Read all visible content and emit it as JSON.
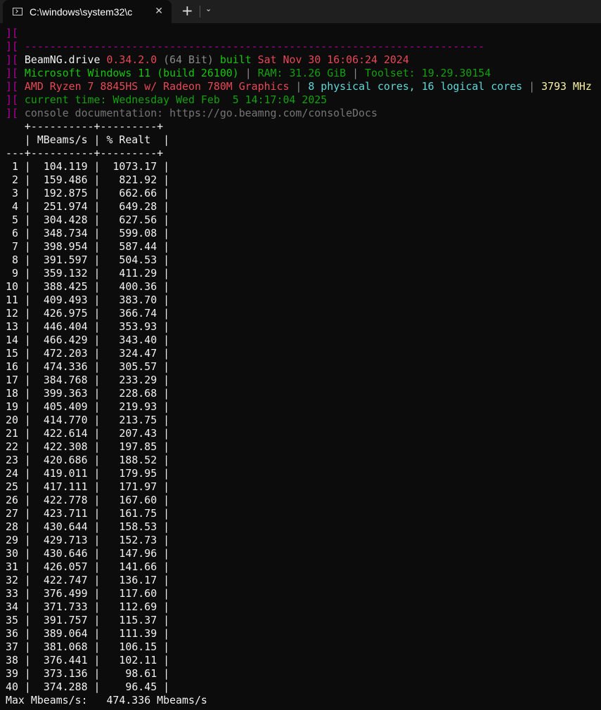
{
  "window": {
    "tab_title": "C:\\windows\\system32\\c",
    "tab_icon": "console-icon",
    "close_glyph": "✕",
    "new_tab_glyph": "+",
    "dropdown_glyph": "⌄"
  },
  "header": {
    "prefix": "][",
    "dashes": "-------------------------------------------------------------------------",
    "line1": {
      "app": "BeamNG.drive",
      "version": "0.34.2.0",
      "arch": "(64 Bit)",
      "built_label": "built",
      "build_date": "Sat Nov 30 16:06:24 2024"
    },
    "line2": {
      "os": "Microsoft Windows 11 (build 26100)",
      "ram": "RAM: 31.26 GiB",
      "toolset": "Toolset: 19.29.30154"
    },
    "line3": {
      "cpu": "AMD Ryzen 7 8845HS w/ Radeon 780M Graphics",
      "cores": "8 physical cores, 16 logical cores",
      "mhz": "3793 MHz"
    },
    "line4": "current time: Wednesday Wed Feb  5 14:17:04 2025",
    "line5": "console documentation: https://go.beamng.com/consoleDocs"
  },
  "table": {
    "border_top": "   +----------+---------+",
    "header_row": "   | MBeams/s | % Realt  |",
    "header_sep": "---+----------+---------+",
    "rows": [
      [
        " 1",
        "104.119",
        "1073.17"
      ],
      [
        " 2",
        "159.486",
        "821.92"
      ],
      [
        " 3",
        "192.875",
        "662.66"
      ],
      [
        " 4",
        "251.974",
        "649.28"
      ],
      [
        " 5",
        "304.428",
        "627.56"
      ],
      [
        " 6",
        "348.734",
        "599.08"
      ],
      [
        " 7",
        "398.954",
        "587.44"
      ],
      [
        " 8",
        "391.597",
        "504.53"
      ],
      [
        " 9",
        "359.132",
        "411.29"
      ],
      [
        "10",
        "388.425",
        "400.36"
      ],
      [
        "11",
        "409.493",
        "383.70"
      ],
      [
        "12",
        "426.975",
        "366.74"
      ],
      [
        "13",
        "446.404",
        "353.93"
      ],
      [
        "14",
        "466.429",
        "343.40"
      ],
      [
        "15",
        "472.203",
        "324.47"
      ],
      [
        "16",
        "474.336",
        "305.57"
      ],
      [
        "17",
        "384.768",
        "233.29"
      ],
      [
        "18",
        "399.363",
        "228.68"
      ],
      [
        "19",
        "405.409",
        "219.93"
      ],
      [
        "20",
        "414.770",
        "213.75"
      ],
      [
        "21",
        "422.614",
        "207.43"
      ],
      [
        "22",
        "422.308",
        "197.85"
      ],
      [
        "23",
        "420.686",
        "188.52"
      ],
      [
        "24",
        "419.011",
        "179.95"
      ],
      [
        "25",
        "417.111",
        "171.97"
      ],
      [
        "26",
        "422.778",
        "167.60"
      ],
      [
        "27",
        "423.711",
        "161.75"
      ],
      [
        "28",
        "430.644",
        "158.53"
      ],
      [
        "29",
        "429.713",
        "152.73"
      ],
      [
        "30",
        "430.646",
        "147.96"
      ],
      [
        "31",
        "426.057",
        "141.66"
      ],
      [
        "32",
        "422.747",
        "136.17"
      ],
      [
        "33",
        "376.499",
        "117.60"
      ],
      [
        "34",
        "371.733",
        "112.69"
      ],
      [
        "35",
        "391.757",
        "115.37"
      ],
      [
        "36",
        "389.064",
        "111.39"
      ],
      [
        "37",
        "381.068",
        "106.15"
      ],
      [
        "38",
        "376.441",
        "102.11"
      ],
      [
        "39",
        "373.136",
        "98.61"
      ],
      [
        "40",
        "374.288",
        "96.45"
      ]
    ],
    "footer": "Max Mbeams/s:   474.336 Mbeams/s"
  }
}
